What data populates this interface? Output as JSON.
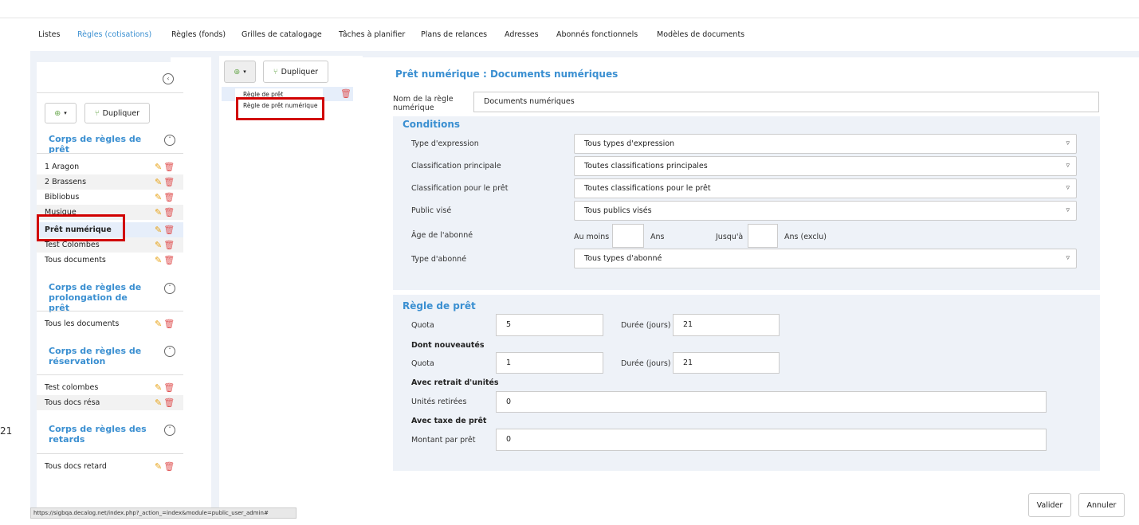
{
  "tabs": [
    "Listes",
    "Règles (cotisations)",
    "Règles (fonds)",
    "Grilles de catalogage",
    "Tâches à planifier",
    "Plans de relances",
    "Adresses",
    "Abonnés fonctionnels",
    "Modèles de documents"
  ],
  "left": {
    "collapse_icon": "chevron-left-icon",
    "add_icon": "plus-circle-icon",
    "duplicate_label": "Dupliquer",
    "sections": [
      {
        "title": "Corps de règles de prêt",
        "items": [
          "1 Aragon",
          "2 Brassens",
          "Bibliobus",
          "Musique",
          "Prêt numérique",
          "Test Colombes",
          "Tous documents"
        ]
      },
      {
        "title": "Corps de règles de prolongation de prêt",
        "items": [
          "Tous les documents"
        ]
      },
      {
        "title": "Corps de règles de réservation",
        "items": [
          "Test colombes",
          "Tous docs résa"
        ]
      },
      {
        "title": "Corps de règles des retards",
        "items": [
          "Tous docs retard"
        ]
      }
    ]
  },
  "middle": {
    "duplicate_label": "Dupliquer",
    "menu": [
      "Règle de prêt",
      "Règle de prêt numérique"
    ]
  },
  "form": {
    "title": "Prêt numérique : Documents numériques",
    "name_label": "Nom de la règle numérique",
    "name_value": "Documents numériques",
    "conditions_title": "Conditions",
    "conditions": [
      {
        "label": "Type d'expression",
        "value": "Tous types d'expression"
      },
      {
        "label": "Classification principale",
        "value": "Toutes classifications principales"
      },
      {
        "label": "Classification pour le prêt",
        "value": "Toutes classifications pour le prêt"
      },
      {
        "label": "Public visé",
        "value": "Tous publics visés"
      }
    ],
    "age_label": "Âge de l'abonné",
    "age_min_label": "Au moins",
    "age_min_unit": "Ans",
    "age_max_label": "Jusqu'à",
    "age_max_unit": "Ans (exclu)",
    "subscriber_type_label": "Type d'abonné",
    "subscriber_type_value": "Tous types d'abonné",
    "loan_rule_title": "Règle de prêt",
    "quota_label": "Quota",
    "quota_value": "5",
    "duration_label": "Durée (jours)",
    "duration_value": "21",
    "new_title": "Dont nouveautés",
    "new_quota_label": "Quota",
    "new_quota_value": "1",
    "new_duration_label": "Durée (jours)",
    "new_duration_value": "21",
    "units_title": "Avec retrait d'unités",
    "units_label": "Unités retirées",
    "units_value": "0",
    "tax_title": "Avec taxe de prêt",
    "tax_label": "Montant par prêt",
    "tax_value": "0"
  },
  "actions": {
    "validate": "Valider",
    "cancel": "Annuler"
  },
  "status_url": "https://sigbqa.decalog.net/index.php?_action_=index&module=public_user_admin#",
  "edge_number": "21"
}
